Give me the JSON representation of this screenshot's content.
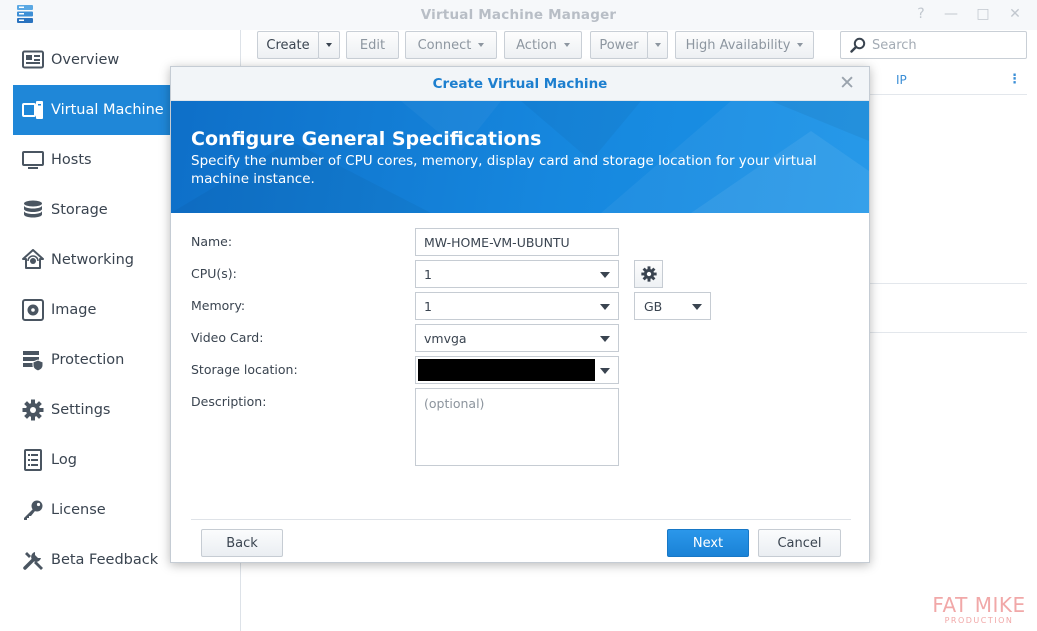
{
  "window": {
    "title": "Virtual Machine Manager",
    "controls": [
      "?",
      "—",
      "□",
      "✕"
    ]
  },
  "sidebar": {
    "items": [
      {
        "label": "Overview",
        "icon": "overview-icon",
        "active": false
      },
      {
        "label": "Virtual Machine",
        "icon": "virtual-machine-icon",
        "active": true
      },
      {
        "label": "Hosts",
        "icon": "hosts-icon",
        "active": false
      },
      {
        "label": "Storage",
        "icon": "storage-icon",
        "active": false
      },
      {
        "label": "Networking",
        "icon": "networking-icon",
        "active": false
      },
      {
        "label": "Image",
        "icon": "image-icon",
        "active": false
      },
      {
        "label": "Protection",
        "icon": "protection-icon",
        "active": false
      },
      {
        "label": "Settings",
        "icon": "settings-icon",
        "active": false
      },
      {
        "label": "Log",
        "icon": "log-icon",
        "active": false
      },
      {
        "label": "License",
        "icon": "license-icon",
        "active": false
      },
      {
        "label": "Beta Feedback",
        "icon": "beta-feedback-icon",
        "active": false
      }
    ]
  },
  "toolbar": {
    "create": "Create",
    "edit": "Edit",
    "connect": "Connect",
    "action": "Action",
    "power": "Power",
    "high_availability": "High Availability",
    "search_placeholder": "Search"
  },
  "grid": {
    "ip_header": "IP",
    "column_menu": "⋮"
  },
  "dialog": {
    "title": "Create Virtual Machine",
    "close": "✕",
    "banner_title": "Configure General Specifications",
    "banner_text": "Specify the number of CPU cores, memory, display card and storage location for your virtual machine instance.",
    "fields": {
      "name_label": "Name:",
      "name_value": "MW-HOME-VM-UBUNTU",
      "cpu_label": "CPU(s):",
      "cpu_value": "1",
      "memory_label": "Memory:",
      "memory_value": "1",
      "memory_unit": "GB",
      "video_label": "Video Card:",
      "video_value": "vmvga",
      "storage_label": "Storage location:",
      "description_label": "Description:",
      "description_placeholder": "(optional)"
    },
    "buttons": {
      "back": "Back",
      "next": "Next",
      "cancel": "Cancel"
    }
  },
  "watermark": {
    "line1": "FAT MIKE",
    "line2": "PRODUCTION"
  },
  "colors": {
    "accent": "#1f87d8",
    "banner": "#1687de",
    "primary_button": "#1a82d6",
    "dialog_title": "#1d7fcf"
  }
}
